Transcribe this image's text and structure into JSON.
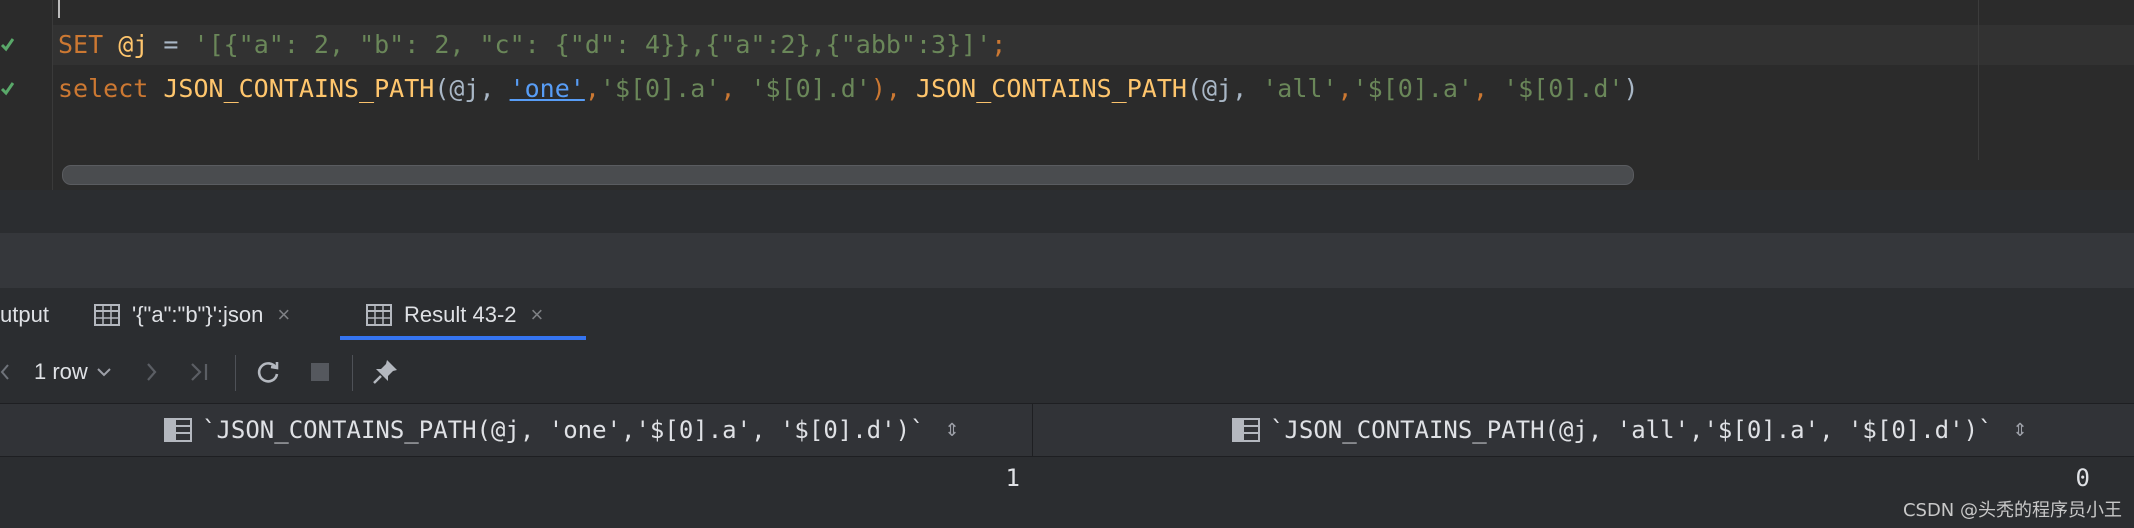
{
  "editor": {
    "line1": {
      "kw": "SET",
      "var": "@j",
      "eq": "=",
      "str": "'[{\"a\": 2, \"b\": 2, \"c\": {\"d\": 4}},{\"a\":2},{\"abb\":3}]'",
      "semi": ";"
    },
    "line2": {
      "kw": "select",
      "fn1": "JSON_CONTAINS_PATH",
      "p1": "(@j, ",
      "one": "'one'",
      "c1": ",",
      "s1": "'$[0].a'",
      "c2": ", ",
      "s2": "'$[0].d'",
      "close1": "), ",
      "fn2": "JSON_CONTAINS_PATH",
      "p2": "(@j, ",
      "all": "'all'",
      "c3": ",",
      "s3": "'$[0].a'",
      "c4": ", ",
      "s4": "'$[0].d'",
      "close2": ")"
    }
  },
  "tabs": [
    {
      "label": "utput"
    },
    {
      "label": "'{\"a\":\"b\"}':json",
      "close": "×"
    },
    {
      "label": "Result 43-2",
      "close": "×"
    }
  ],
  "toolbar": {
    "rows": "1 row",
    "chevron": "⌄",
    "next": "›",
    "last": "›|"
  },
  "table": {
    "columns": [
      "`JSON_CONTAINS_PATH(@j, 'one','$[0].a', '$[0].d')`",
      "`JSON_CONTAINS_PATH(@j, 'all','$[0].a', '$[0].d')`"
    ],
    "sort_glyph": "⇕",
    "rows": [
      [
        "1",
        "0"
      ]
    ]
  },
  "watermark": "CSDN @头秃的程序员小王",
  "colors": {
    "accent": "#3574f0",
    "keyword": "#cc7832",
    "function": "#ffc66d",
    "string": "#6a8759"
  }
}
